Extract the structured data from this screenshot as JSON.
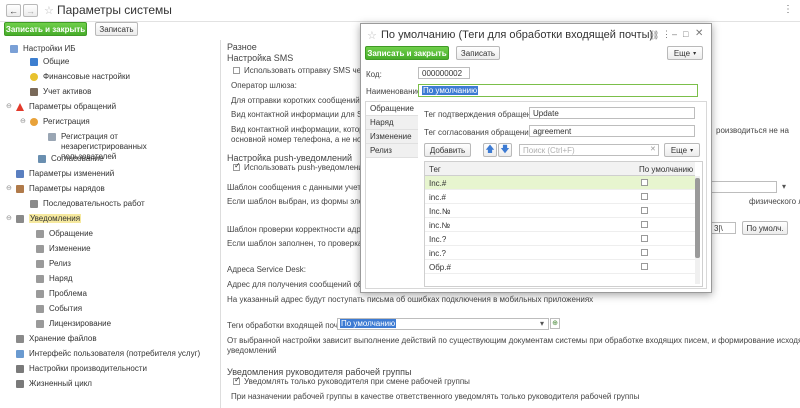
{
  "window": {
    "title": "Параметры системы"
  },
  "toolbar": {
    "save_close": "Записать и закрыть",
    "save": "Записать",
    "more": "⋮"
  },
  "tree": [
    {
      "label": "Настройки ИБ"
    },
    {
      "label": "Общие"
    },
    {
      "label": "Финансовые настройки"
    },
    {
      "label": "Учет активов"
    },
    {
      "label": "Параметры обращений"
    },
    {
      "label": "Регистрация"
    },
    {
      "label": "Регистрация от незарегистрированных пользователей"
    },
    {
      "label": "Согласование"
    },
    {
      "label": "Параметры изменений"
    },
    {
      "label": "Параметры нарядов"
    },
    {
      "label": "Последовательность работ"
    },
    {
      "label": "Уведомления"
    },
    {
      "label": "Обращение"
    },
    {
      "label": "Изменение"
    },
    {
      "label": "Релиз"
    },
    {
      "label": "Наряд"
    },
    {
      "label": "Проблема"
    },
    {
      "label": "События"
    },
    {
      "label": "Лицензирование"
    },
    {
      "label": "Хранение файлов"
    },
    {
      "label": "Интерфейс пользователя (потребителя услуг)"
    },
    {
      "label": "Настройки производительности"
    },
    {
      "label": "Жизненный цикл"
    }
  ],
  "main": {
    "misc_title": "Разное",
    "sms_title": "Настройка SMS",
    "sms_checkbox": "Использовать отправку SMS чере",
    "gateway_label": "Оператор шлюза:",
    "sms_hint": "Для отправки коротких сообщений (SMS",
    "contact_label": "Вид контактной информации для SMS",
    "contact_hint1": "Вид контактной информации, который",
    "contact_hint2": "основной номер телефона, а не номер",
    "right_hint": "роизводиться не на",
    "right_hint2": "физического лица",
    "push_title": "Настройка push-уведомлений",
    "push_checkbox": "Использовать push-уведомления",
    "push_template_label": "Шаблон сообщения с данными учетной",
    "push_template_hint": "Если шаблон выбран, из формы элеме",
    "addr_check_label": "Шаблон проверки корректности адреса",
    "addr_check_value": "3|\\",
    "addr_check_btn": "По умолч.",
    "addr_check_hint": "Если шаблон заполнен, то проверка ко",
    "service_desk_label": "Адреса Service Desk:",
    "errors_addr_label": "Адрес для получения сообщений об ош",
    "errors_addr_hint": "На указанный адрес будут поступать письма об ошибках подключения в мобильных приложениях",
    "incoming_tags_label": "Теги обработки входящей почты:",
    "incoming_tags_value": "По умолчанию",
    "incoming_tags_hint1": "От выбранной настройки зависит выполнение действий по существующим документам системы при обработке входящих писем, и формирование исходящих",
    "incoming_tags_hint2": "уведомлений",
    "managers_title": "Уведомления руководителя рабочей группы",
    "managers_checkbox": "Уведомлять только руководителя при смене рабочей группы",
    "managers_hint": "При назначении рабочей группы в качестве ответственного уведомлять только руководителя рабочей группы"
  },
  "dialog": {
    "title": "По умолчанию (Теги для обработки входящей почты)",
    "save_close": "Записать и закрыть",
    "save": "Записать",
    "more": "Еще",
    "code_label": "Код:",
    "code_value": "000000002",
    "name_label": "Наименование:",
    "name_value": "По умолчанию",
    "tabs": [
      "Обращение",
      "Наряд",
      "Изменение",
      "Релиз"
    ],
    "confirm_label": "Тег подтверждения обращения:",
    "confirm_value": "Update",
    "approve_label": "Тег согласования обращения:",
    "approve_value": "agreement",
    "add_btn": "Добавить",
    "search_placeholder": "Поиск (Ctrl+F)",
    "more2": "Еще",
    "col_tag": "Тег",
    "col_default": "По умолчанию",
    "rows": [
      "Inc.#",
      "inc.#",
      "Inc.№",
      "inc.№",
      "Inc.?",
      "inc.?",
      "Обр.#"
    ]
  }
}
